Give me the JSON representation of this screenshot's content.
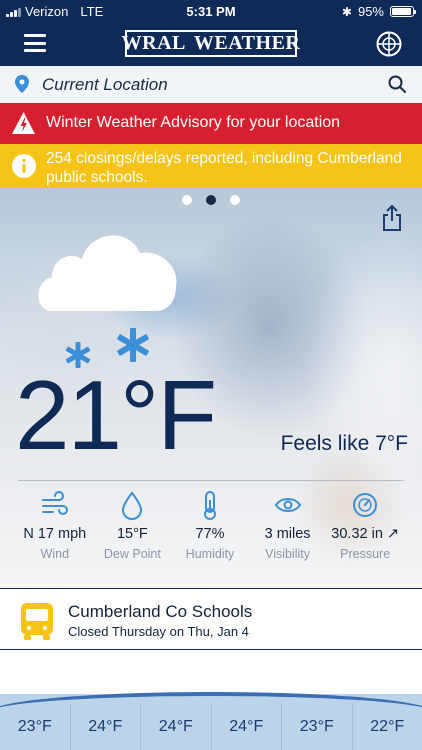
{
  "status_bar": {
    "carrier": "Verizon",
    "network": "LTE",
    "time": "5:31 PM",
    "battery": "95%",
    "battery_level": 0.95
  },
  "nav": {
    "logo_left": "WRAL",
    "logo_right": "WEATHER"
  },
  "location": {
    "label": "Current Location"
  },
  "alerts": {
    "advisory": "Winter Weather Advisory for your location",
    "closings": "254 closings/delays reported, including Cumberland public schools."
  },
  "pager": {
    "count": 3,
    "active": 1
  },
  "current": {
    "temperature": "21°F",
    "feels_like": "Feels like 7°F",
    "condition_icon": "cloud-snow-icon"
  },
  "metrics": [
    {
      "value": "N 17 mph",
      "label": "Wind",
      "icon": "wind-icon"
    },
    {
      "value": "15°F",
      "label": "Dew Point",
      "icon": "droplet-icon"
    },
    {
      "value": "77%",
      "label": "Humidity",
      "icon": "thermometer-icon"
    },
    {
      "value": "3 miles",
      "label": "Visibility",
      "icon": "eye-icon"
    },
    {
      "value": "30.32 in ↗",
      "label": "Pressure",
      "icon": "gauge-icon"
    }
  ],
  "school": {
    "title": "Cumberland Co Schools",
    "subtitle": "Closed Thursday on Thu, Jan 4"
  },
  "hourly": [
    "23°F",
    "24°F",
    "24°F",
    "24°F",
    "23°F",
    "22°F"
  ],
  "colors": {
    "navy": "#0f2a57",
    "alert_red": "#d6202f",
    "alert_yellow": "#f5c416",
    "accent_blue": "#3a8fd8"
  }
}
